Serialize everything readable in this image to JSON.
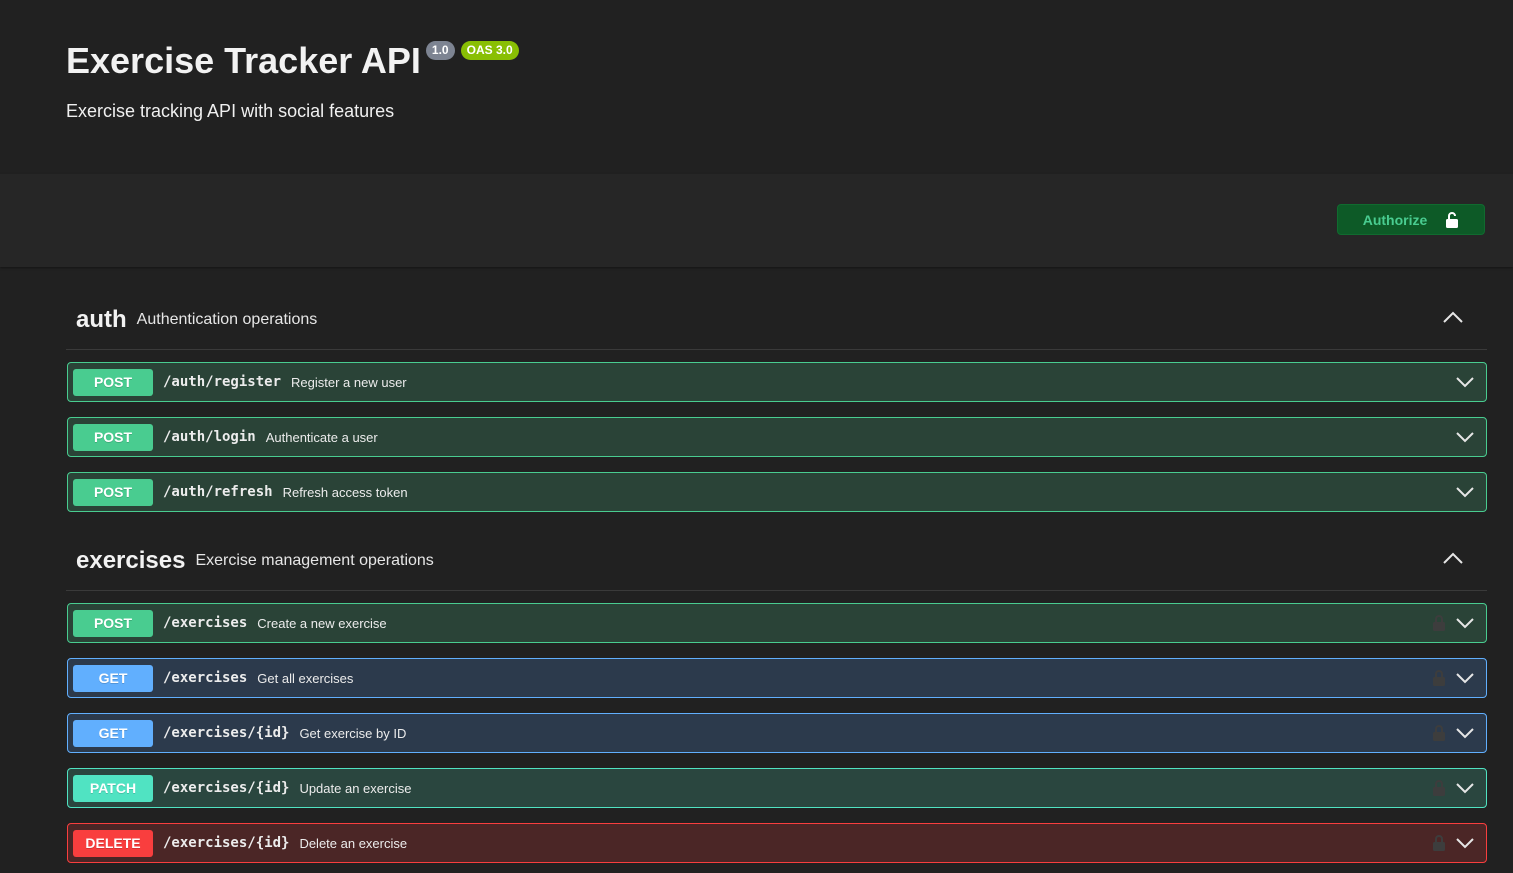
{
  "info": {
    "title": "Exercise Tracker API",
    "version_badge": "1.0",
    "oas_badge": "OAS 3.0",
    "description": "Exercise tracking API with social features"
  },
  "authorize": {
    "label": "Authorize",
    "icon": "unlock-icon"
  },
  "colors": {
    "post": "#49cc90",
    "get": "#61affe",
    "patch": "#50e3c2",
    "delete": "#f93e3e",
    "authorize_text": "#49cc90",
    "authorize_bg": "#0d5a27"
  },
  "tags": [
    {
      "name": "auth",
      "description": "Authentication operations",
      "operations": [
        {
          "method": "POST",
          "path": "/auth/register",
          "summary": "Register a new user",
          "locked": false
        },
        {
          "method": "POST",
          "path": "/auth/login",
          "summary": "Authenticate a user",
          "locked": false
        },
        {
          "method": "POST",
          "path": "/auth/refresh",
          "summary": "Refresh access token",
          "locked": false
        }
      ]
    },
    {
      "name": "exercises",
      "description": "Exercise management operations",
      "operations": [
        {
          "method": "POST",
          "path": "/exercises",
          "summary": "Create a new exercise",
          "locked": true
        },
        {
          "method": "GET",
          "path": "/exercises",
          "summary": "Get all exercises",
          "locked": true
        },
        {
          "method": "GET",
          "path": "/exercises/{id}",
          "summary": "Get exercise by ID",
          "locked": true
        },
        {
          "method": "PATCH",
          "path": "/exercises/{id}",
          "summary": "Update an exercise",
          "locked": true
        },
        {
          "method": "DELETE",
          "path": "/exercises/{id}",
          "summary": "Delete an exercise",
          "locked": true
        }
      ]
    }
  ]
}
